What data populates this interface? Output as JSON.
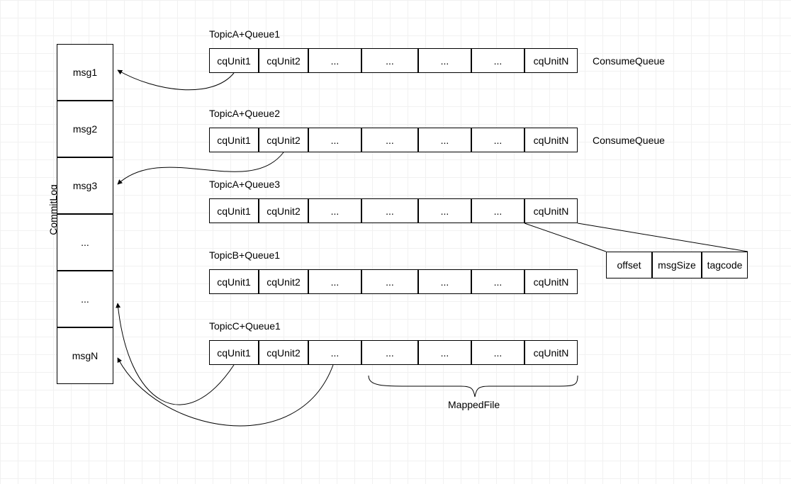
{
  "commitlog": {
    "label": "CommitLog",
    "cells": [
      "msg1",
      "msg2",
      "msg3",
      "...",
      "...",
      "msgN"
    ]
  },
  "queues": [
    {
      "title": "TopicA+Queue1",
      "cells": [
        "cqUnit1",
        "cqUnit2",
        "...",
        "...",
        "...",
        "...",
        "cqUnitN"
      ],
      "right_label": "ConsumeQueue"
    },
    {
      "title": "TopicA+Queue2",
      "cells": [
        "cqUnit1",
        "cqUnit2",
        "...",
        "...",
        "...",
        "...",
        "cqUnitN"
      ],
      "right_label": "ConsumeQueue"
    },
    {
      "title": "TopicA+Queue3",
      "cells": [
        "cqUnit1",
        "cqUnit2",
        "...",
        "...",
        "...",
        "...",
        "cqUnitN"
      ],
      "right_label": ""
    },
    {
      "title": "TopicB+Queue1",
      "cells": [
        "cqUnit1",
        "cqUnit2",
        "...",
        "...",
        "...",
        "...",
        "cqUnitN"
      ],
      "right_label": ""
    },
    {
      "title": "TopicC+Queue1",
      "cells": [
        "cqUnit1",
        "cqUnit2",
        "...",
        "...",
        "...",
        "...",
        "cqUnitN"
      ],
      "right_label": ""
    }
  ],
  "cqunit_detail": {
    "cells": [
      "offset",
      "msgSize",
      "tagcode"
    ]
  },
  "mapped_file_label": "MappedFile"
}
